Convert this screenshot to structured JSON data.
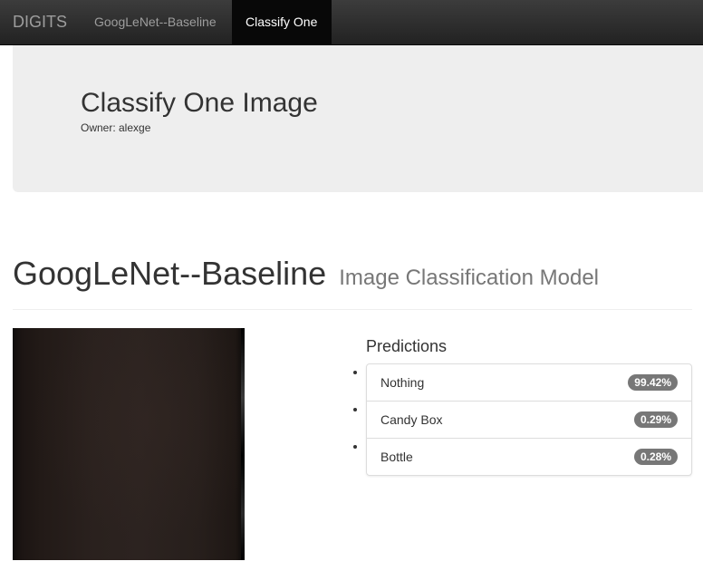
{
  "navbar": {
    "brand": "DIGITS",
    "model_link": "GoogLeNet--Baseline",
    "active_link": "Classify One"
  },
  "jumbotron": {
    "title": "Classify One Image",
    "owner": "Owner: alexge"
  },
  "header": {
    "model_name": "GoogLeNet--Baseline",
    "model_type": "Image Classification Model"
  },
  "predictions": {
    "title": "Predictions",
    "items": [
      {
        "label": "Nothing",
        "value": "99.42%"
      },
      {
        "label": "Candy Box",
        "value": "0.29%"
      },
      {
        "label": "Bottle",
        "value": "0.28%"
      }
    ]
  },
  "colors": {
    "navbar": "#222222",
    "badge": "#777777",
    "jumbotron": "#eeeeee"
  }
}
